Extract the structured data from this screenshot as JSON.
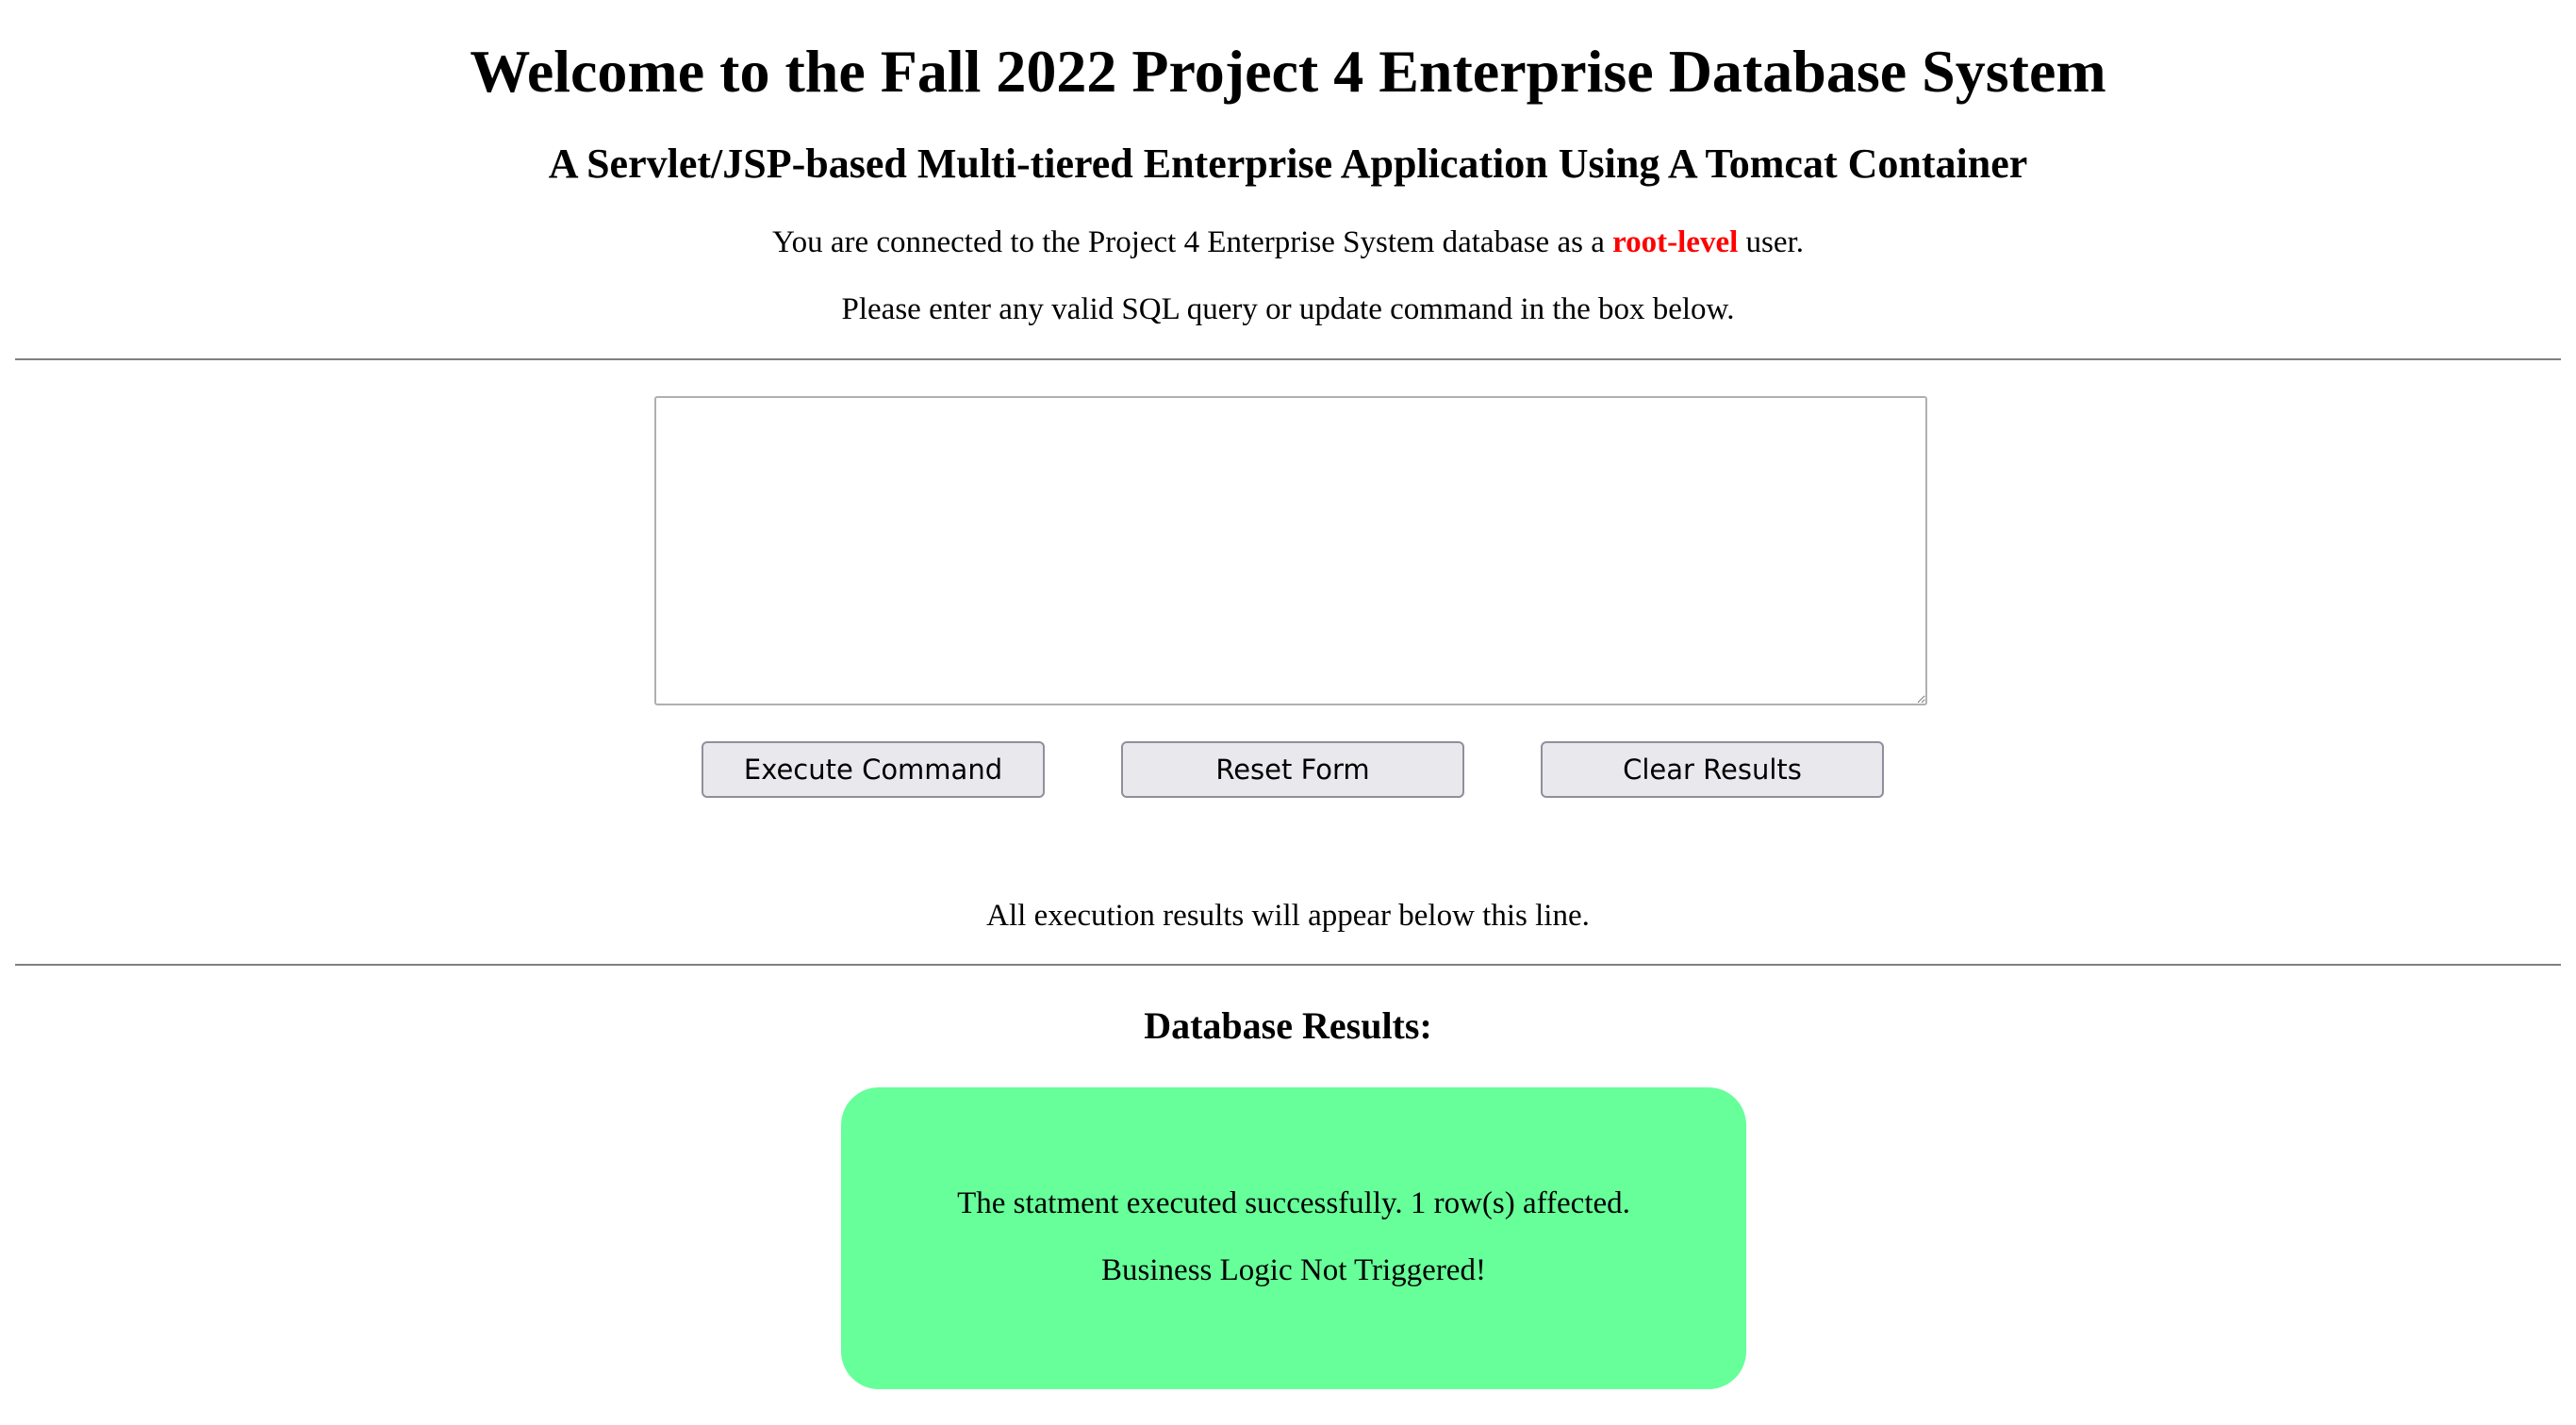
{
  "header": {
    "title": "Welcome to the Fall 2022 Project 4 Enterprise Database System",
    "subtitle": "A Servlet/JSP-based Multi-tiered Enterprise Application Using A Tomcat Container"
  },
  "connection": {
    "prefix": "You are connected to the Project 4 Enterprise System database as a ",
    "role": "root-level",
    "suffix": " user.",
    "role_color": "#ff0000"
  },
  "instructions": "Please enter any valid SQL query or update command in the box below.",
  "query": {
    "value": "",
    "placeholder": ""
  },
  "buttons": {
    "execute": "Execute Command",
    "reset": "Reset Form",
    "clear": "Clear Results"
  },
  "results_notice": "All execution results will appear below this line.",
  "results": {
    "heading": "Database Results:",
    "messages": [
      "The statment executed successfully. 1 row(s) affected.",
      "Business Logic Not Triggered!"
    ],
    "box_color": "#66ff99"
  }
}
